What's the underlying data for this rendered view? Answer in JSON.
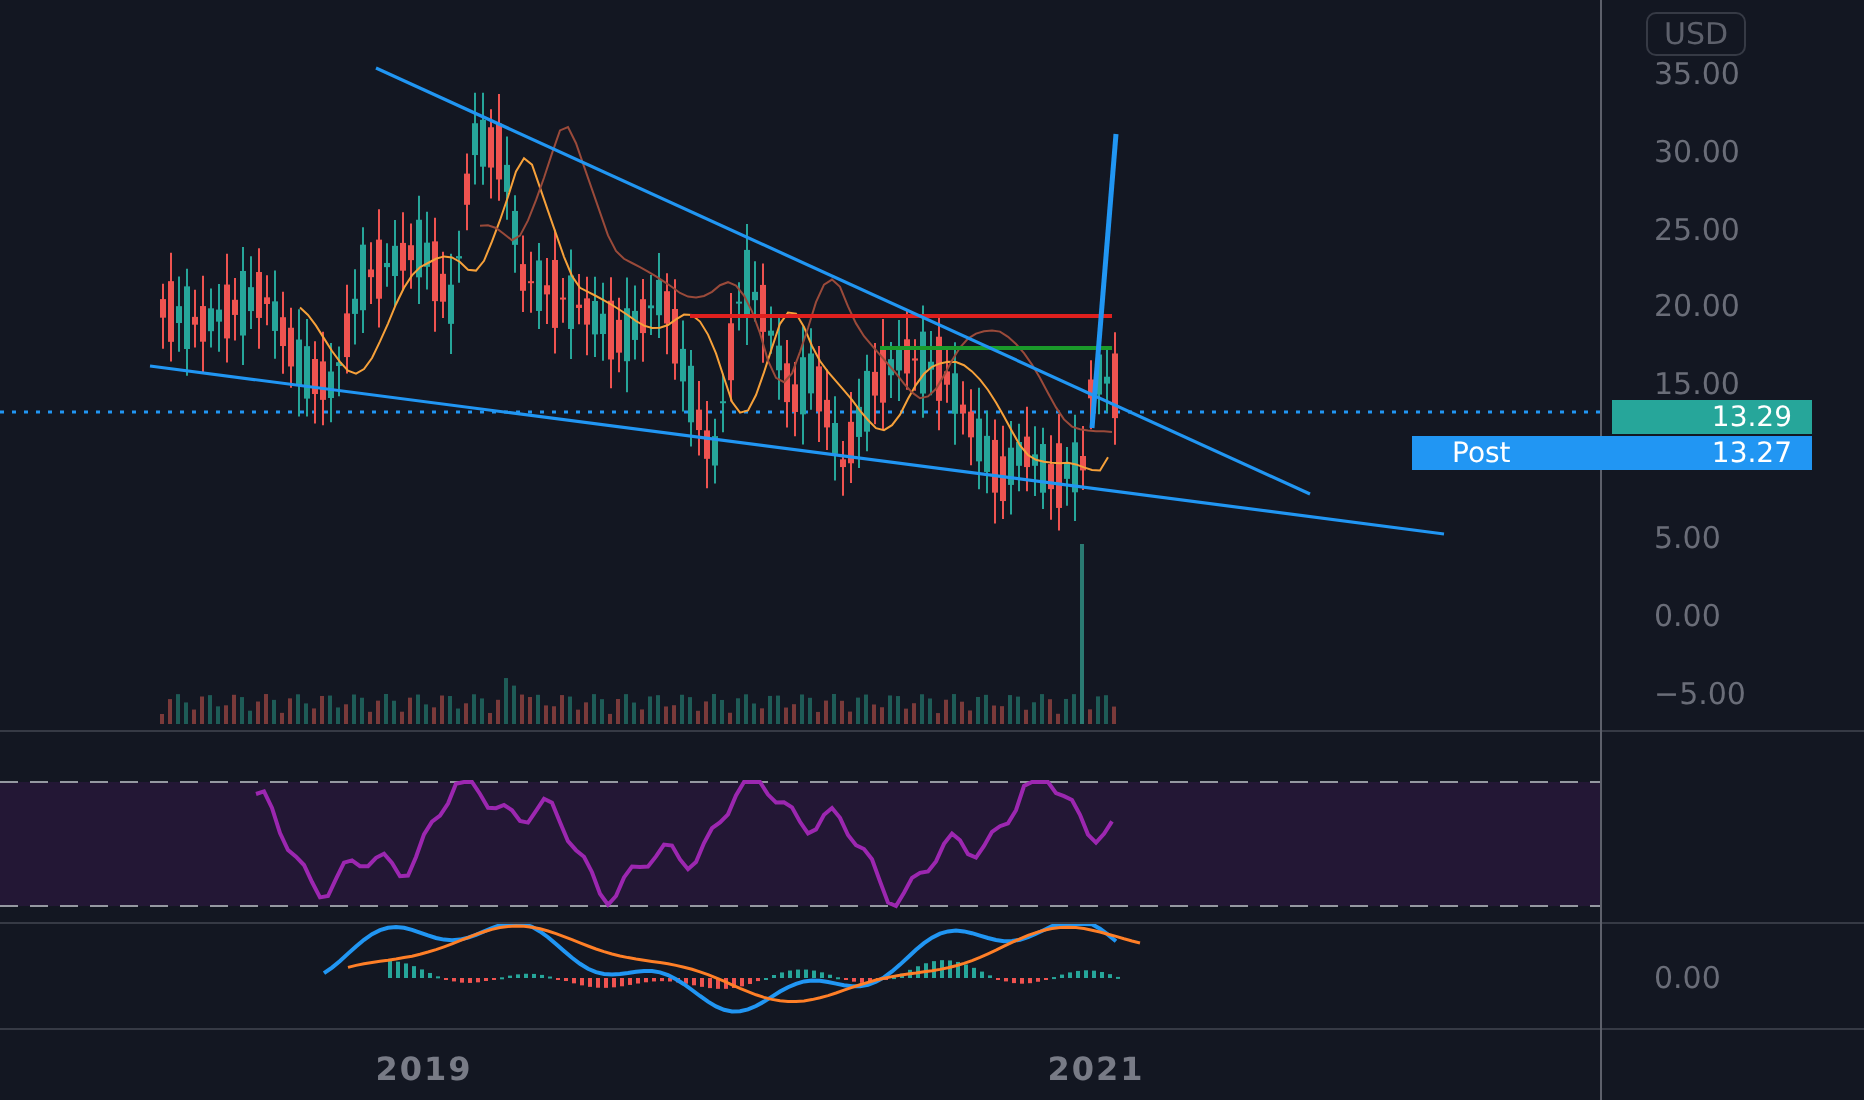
{
  "price_axis": {
    "currency": "USD",
    "ticks": [
      "35.00",
      "30.00",
      "25.00",
      "20.00",
      "15.00",
      "5.00",
      "0.00",
      "−5.00"
    ]
  },
  "price_badges": [
    {
      "value": "13.29",
      "color": "#26a69a"
    },
    {
      "label": "Post",
      "value": "13.27",
      "color": "#2196f3"
    }
  ],
  "macd_axis": {
    "ticks": [
      "0.00"
    ]
  },
  "time_axis": {
    "ticks": [
      "2019",
      "2021"
    ]
  }
}
